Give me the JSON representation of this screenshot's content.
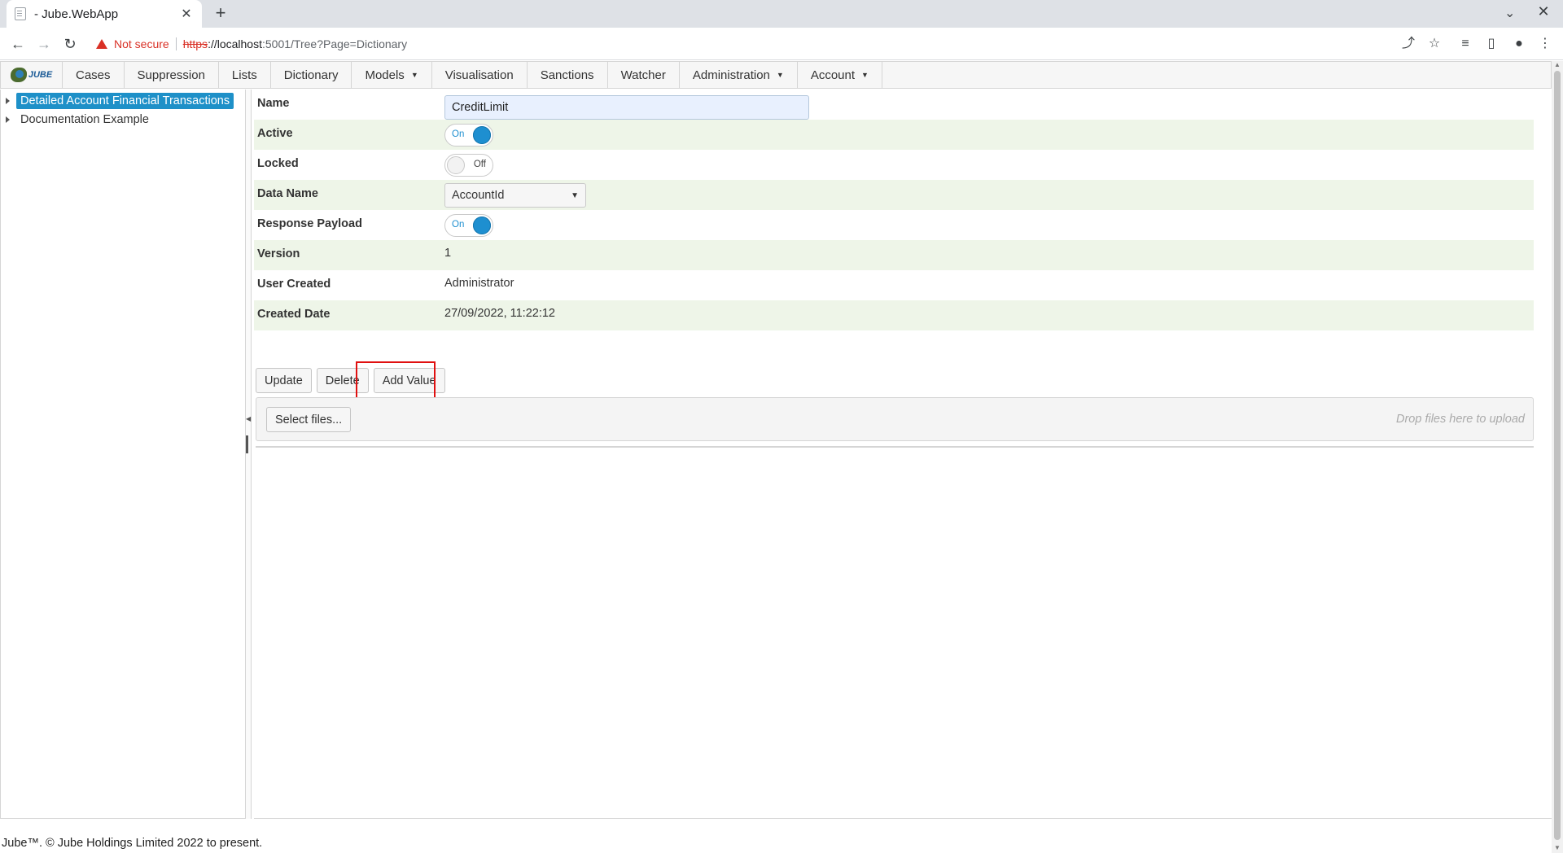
{
  "browser": {
    "tab_title": "- Jube.WebApp",
    "tab_close": "✕",
    "new_tab": "+",
    "security_label": "Not secure",
    "url_scheme": "https",
    "url_host": "://localhost",
    "url_rest": ":5001/Tree?Page=Dictionary"
  },
  "app": {
    "logo_text": "JUBE",
    "menu": [
      {
        "label": "Cases"
      },
      {
        "label": "Suppression"
      },
      {
        "label": "Lists"
      },
      {
        "label": "Dictionary"
      },
      {
        "label": "Models",
        "dropdown": true
      },
      {
        "label": "Visualisation"
      },
      {
        "label": "Sanctions"
      },
      {
        "label": "Watcher"
      },
      {
        "label": "Administration",
        "dropdown": true
      },
      {
        "label": "Account",
        "dropdown": true
      }
    ],
    "tree": [
      {
        "label": "Detailed Account Financial Transactions",
        "selected": true
      },
      {
        "label": "Documentation Example",
        "selected": false
      }
    ],
    "form": {
      "name_label": "Name",
      "name_value": "CreditLimit",
      "active_label": "Active",
      "active_state": "On",
      "locked_label": "Locked",
      "locked_state": "Off",
      "data_name_label": "Data Name",
      "data_name_value": "AccountId",
      "response_payload_label": "Response Payload",
      "response_payload_state": "On",
      "version_label": "Version",
      "version_value": "1",
      "user_created_label": "User Created",
      "user_created_value": "Administrator",
      "created_date_label": "Created Date",
      "created_date_value": "27/09/2022, 11:22:12"
    },
    "buttons": {
      "update": "Update",
      "delete": "Delete",
      "add_value": "Add Value"
    },
    "upload": {
      "select_files": "Select files...",
      "drop_hint": "Drop files here to upload"
    },
    "footer": "Jube™. © Jube Holdings Limited 2022 to present."
  }
}
